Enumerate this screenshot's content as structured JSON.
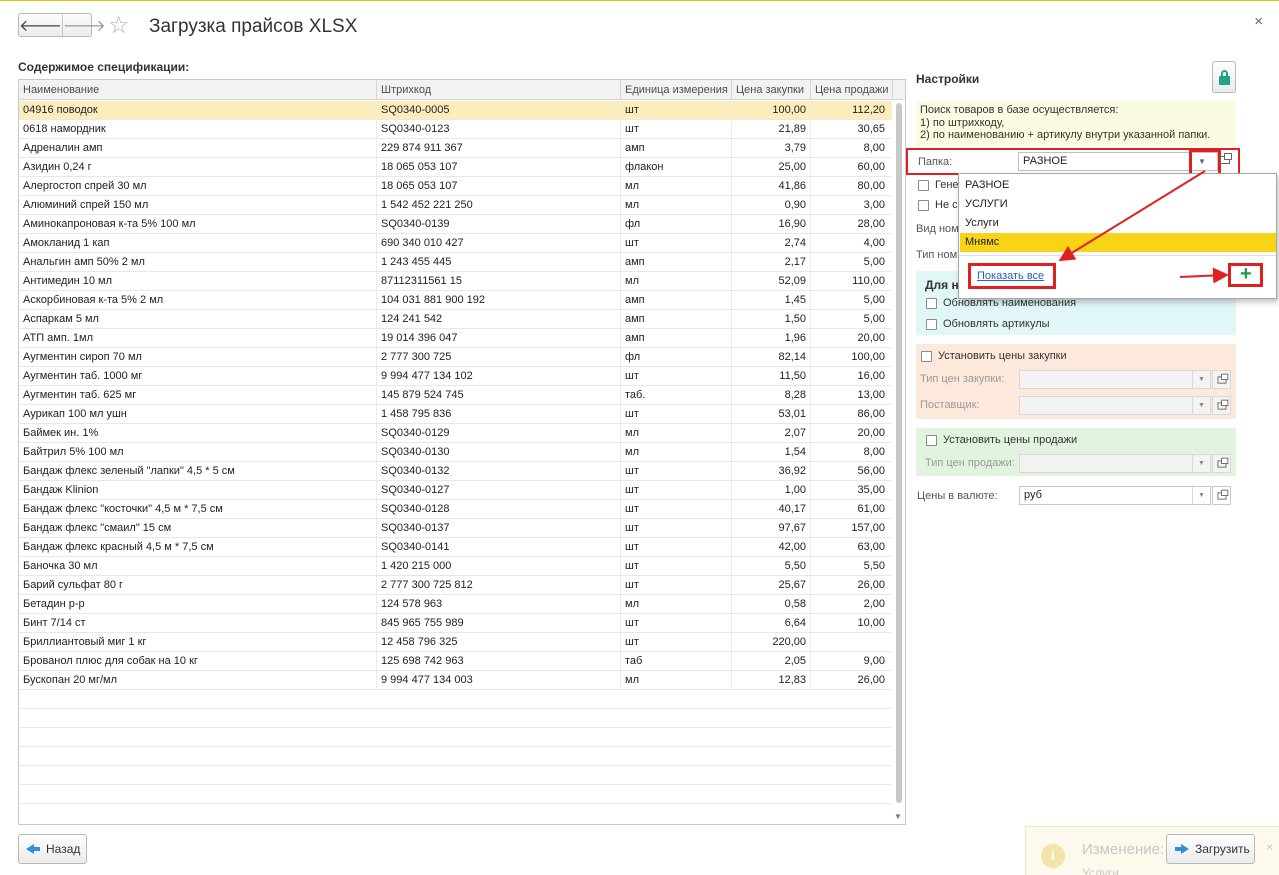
{
  "window": {
    "title": "Загрузка прайсов XLSX",
    "back_arrow": "🡐",
    "fwd_arrow": "🡒",
    "star": "☆",
    "close": "×"
  },
  "spec": {
    "title": "Содержимое спецификации:",
    "columns": [
      "Наименование",
      "Штрихкод",
      "Единица измерения",
      "Цена закупки",
      "Цена продажи"
    ],
    "rows": [
      [
        "04916 поводок",
        "SQ0340-0005",
        "шт",
        "100,00",
        "112,20"
      ],
      [
        "0618 намордник",
        "SQ0340-0123",
        "шт",
        "21,89",
        "30,65"
      ],
      [
        "Адреналин амп",
        "229 874 911 367",
        "амп",
        "3,79",
        "8,00"
      ],
      [
        "Азидин 0,24 г",
        "18 065 053 107",
        "флакон",
        "25,00",
        "60,00"
      ],
      [
        "Алергостоп спрей 30 мл",
        "18 065 053 107",
        "мл",
        "41,86",
        "80,00"
      ],
      [
        "Алюминий спрей 150 мл",
        "1 542 452 221 250",
        "мл",
        "0,90",
        "3,00"
      ],
      [
        "Аминокапроновая к-та 5%  100 мл",
        "SQ0340-0139",
        "фл",
        "16,90",
        "28,00"
      ],
      [
        "Амокланид 1 кап",
        "690 340 010 427",
        "шт",
        "2,74",
        "4,00"
      ],
      [
        "Анальгин амп 50% 2 мл",
        "1 243 455 445",
        "амп",
        "2,17",
        "5,00"
      ],
      [
        "Антимедин 10 мл",
        "87112311561 15",
        "мл",
        "52,09",
        "110,00"
      ],
      [
        "Аскорбиновая к-та 5% 2 мл",
        "104 031 881 900 192",
        "амп",
        "1,45",
        "5,00"
      ],
      [
        "Аспаркам 5 мл",
        "124 241 542",
        "амп",
        "1,50",
        "5,00"
      ],
      [
        "АТП амп. 1мл",
        "19 014 396 047",
        "амп",
        "1,96",
        "20,00"
      ],
      [
        "Аугментин сироп 70 мл",
        "2 777 300 725",
        "фл",
        "82,14",
        "100,00"
      ],
      [
        "Аугментин таб. 1000 мг",
        "9 994 477 134 102",
        "шт",
        "11,50",
        "16,00"
      ],
      [
        "Аугментин таб. 625 мг",
        "145 879 524 745",
        "таб.",
        "8,28",
        "13,00"
      ],
      [
        "Аурикап 100 мл ушн",
        "1 458 795 836",
        "шт",
        "53,01",
        "86,00"
      ],
      [
        "Баймек ин. 1%",
        "SQ0340-0129",
        "мл",
        "2,07",
        "20,00"
      ],
      [
        "Байтрил 5% 100 мл",
        "SQ0340-0130",
        "мл",
        "1,54",
        "8,00"
      ],
      [
        "Бандаж  флекс зеленый  \"лапки\" 4,5 * 5 см",
        "SQ0340-0132",
        "шт",
        "36,92",
        "56,00"
      ],
      [
        "Бандаж Klinion",
        "SQ0340-0127",
        "шт",
        "1,00",
        "35,00"
      ],
      [
        "Бандаж флекс \"косточки\"  4,5 м * 7,5 см",
        "SQ0340-0128",
        "шт",
        "40,17",
        "61,00"
      ],
      [
        "Бандаж флекс \"смаил\" 15 см",
        "SQ0340-0137",
        "шт",
        "97,67",
        "157,00"
      ],
      [
        "Бандаж флекс красный 4,5 м * 7,5 см",
        "SQ0340-0141",
        "шт",
        "42,00",
        "63,00"
      ],
      [
        "Баночка 30 мл",
        "1 420 215 000",
        "шт",
        "5,50",
        "5,50"
      ],
      [
        "Барий сульфат 80 г",
        "2 777 300 725 812",
        "шт",
        "25,67",
        "26,00"
      ],
      [
        "Бетадин р-р",
        "124 578 963",
        "мл",
        "0,58",
        "2,00"
      ],
      [
        "Бинт 7/14 ст",
        "845 965 755 989",
        "шт",
        "6,64",
        "10,00"
      ],
      [
        "Бриллиантовый миг 1 кг",
        "12 458 796 325",
        "шт",
        "220,00",
        ""
      ],
      [
        "Брованол плюс для собак на 10 кг",
        "125 698 742 963",
        "таб",
        "2,05",
        "9,00"
      ],
      [
        "Бускопан 20 мг/мл",
        "9 994 477 134 003",
        "мл",
        "12,83",
        "26,00"
      ]
    ]
  },
  "buttons": {
    "back": "Назад",
    "load": "Загрузить"
  },
  "settings": {
    "title": "Настройки",
    "info_lines": [
      "Поиск товаров в базе осуществляется:",
      "1) по штрихкоду,",
      "2) по наименованию + артикулу внутри указанной папки."
    ],
    "folder_label": "Папка:",
    "folder_value": "РАЗНОЕ",
    "check1_partial": "Гене",
    "check2_partial": "Не с",
    "vid_partial": "Вид ном",
    "tip_partial": "Тип ном",
    "for_partial": "Для н",
    "update_names": "Обновлять наименования",
    "update_articles": "Обновлять артикулы",
    "set_purchase_prices": "Установить цены закупки",
    "purchase_price_type": "Тип цен закупки:",
    "supplier": "Поставщик:",
    "set_sale_prices": "Установить цены продажи",
    "sale_price_type": "Тип цен продажи:",
    "currency_label": "Цены в валюте:",
    "currency_value": "руб"
  },
  "dropdown": {
    "items": [
      "РАЗНОЕ",
      "УСЛУГИ",
      "Услуги",
      "Мнямс"
    ],
    "active_index": 3,
    "show_all": "Показать все",
    "add": "+"
  },
  "notification": {
    "icon": "i",
    "title": "Изменение:",
    "subtitle": "Услуги",
    "close": "×"
  }
}
